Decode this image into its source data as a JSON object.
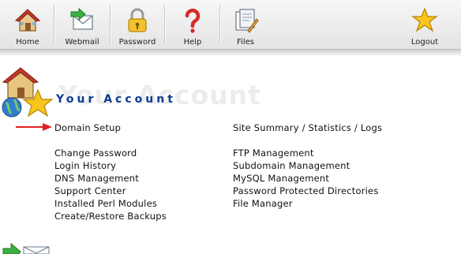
{
  "toolbar": {
    "items": [
      {
        "label": "Home",
        "icon": "house-icon"
      },
      {
        "label": "Webmail",
        "icon": "envelope-icon"
      },
      {
        "label": "Password",
        "icon": "padlock-icon"
      },
      {
        "label": "Help",
        "icon": "question-mark-icon"
      },
      {
        "label": "Files",
        "icon": "files-icon"
      },
      {
        "label": "Logout",
        "icon": "star-icon"
      }
    ]
  },
  "section": {
    "title": "Your Account",
    "ghost_title": "Your Account",
    "icon": "account-icon"
  },
  "links": {
    "left": [
      "Domain Setup",
      "Change Password",
      "Login History",
      "DNS Management",
      "Support Center",
      "Installed Perl Modules",
      "Create/Restore Backups"
    ],
    "right": [
      "Site Summary / Statistics / Logs",
      "FTP Management",
      "Subdomain Management",
      "MySQL Management",
      "Password Protected Directories",
      "File Manager"
    ]
  },
  "colors": {
    "title": "#0b3d91",
    "arrow": "#e02020",
    "link_text": "#111111"
  }
}
